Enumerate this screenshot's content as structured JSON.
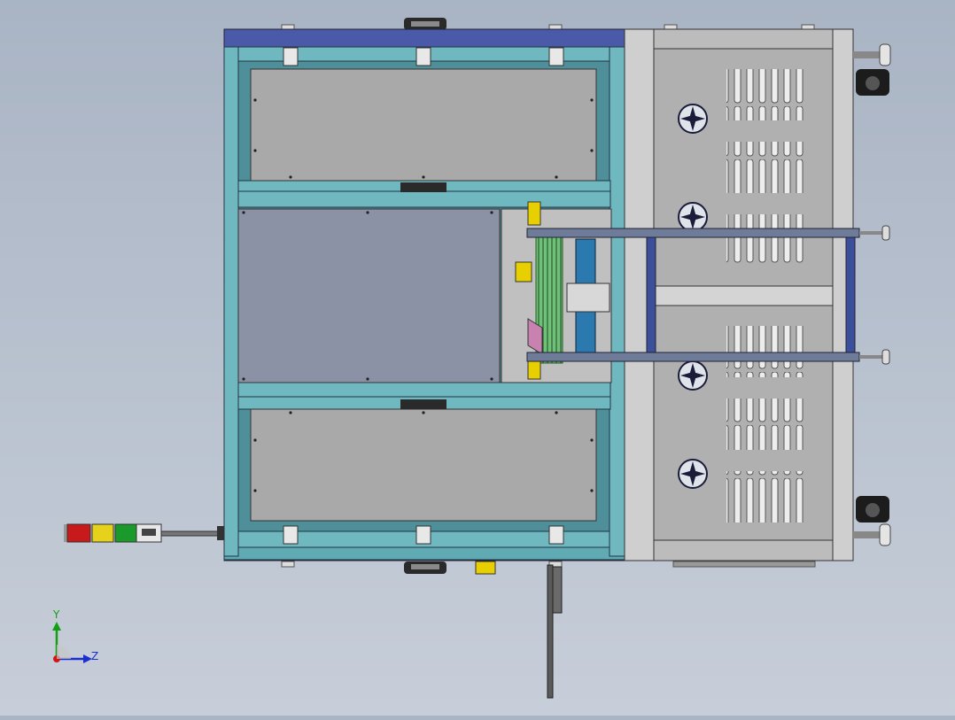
{
  "viewport": {
    "background_top": "#a9b4c4",
    "background_bottom": "#c7ced9"
  },
  "triad": {
    "y_label": "Y",
    "z_label": "Z",
    "y_color": "#12a012",
    "z_color": "#1b2fd0",
    "x_color": "#d01818"
  },
  "colors": {
    "frame_teal": "#5faab3",
    "frame_dark": "#3f6e78",
    "top_rail_blue": "#4a5aa8",
    "panel_gray": "#a9a9a9",
    "center_panel": "#8c92a6",
    "cabinet_gray": "#b5b5b5",
    "stack_light_red": "#c81a1a",
    "stack_light_yellow": "#e6d21a",
    "stack_light_green": "#1a9a2a",
    "yellow_part": "#e8d000"
  },
  "icons": {
    "fan": "fan-icon",
    "triad": "axis-triad-icon",
    "stack_light": "stack-light-icon"
  }
}
